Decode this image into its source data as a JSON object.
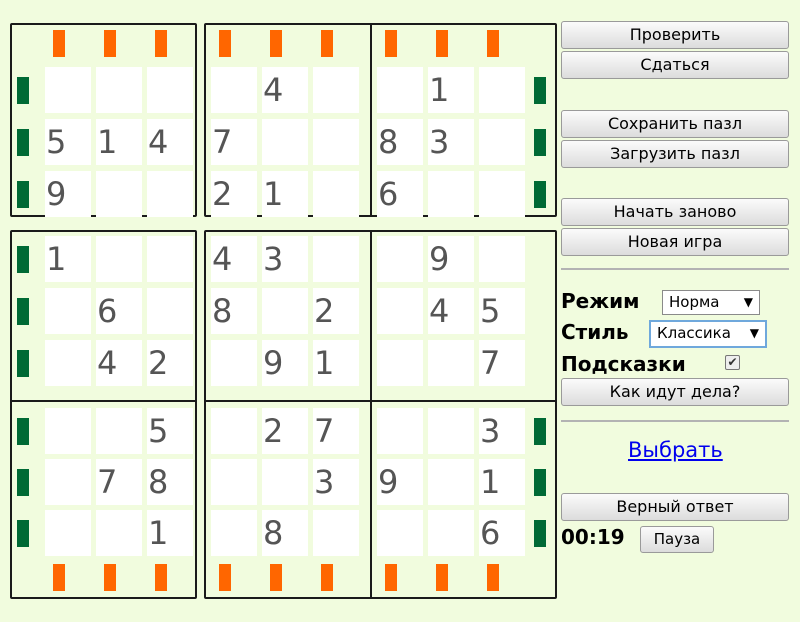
{
  "puzzle": {
    "boxes": [
      [
        [
          "",
          "",
          ""
        ],
        [
          "5",
          "1",
          "4"
        ],
        [
          "9",
          "",
          ""
        ]
      ],
      [
        [
          "",
          "4",
          ""
        ],
        [
          "7",
          "",
          ""
        ],
        [
          "2",
          "1",
          ""
        ]
      ],
      [
        [
          "",
          "1",
          ""
        ],
        [
          "8",
          "3",
          ""
        ],
        [
          "6",
          "",
          ""
        ]
      ],
      [
        [
          "1",
          "",
          ""
        ],
        [
          "",
          "6",
          ""
        ],
        [
          "",
          "4",
          "2"
        ]
      ],
      [
        [
          "4",
          "3",
          ""
        ],
        [
          "8",
          "",
          "2"
        ],
        [
          "",
          "9",
          "1"
        ]
      ],
      [
        [
          "",
          "9",
          ""
        ],
        [
          "",
          "4",
          "5"
        ],
        [
          "",
          "",
          "7"
        ]
      ],
      [
        [
          "",
          "",
          "5"
        ],
        [
          "",
          "7",
          "8"
        ],
        [
          "",
          "",
          "1"
        ]
      ],
      [
        [
          "",
          "2",
          "7"
        ],
        [
          "",
          "",
          "3"
        ],
        [
          "",
          "8",
          ""
        ]
      ],
      [
        [
          "",
          "",
          "3"
        ],
        [
          "9",
          "",
          "1"
        ],
        [
          "",
          "",
          "6"
        ]
      ]
    ]
  },
  "colors": {
    "background": "#f1fcde",
    "orange_mark": "#ff6600",
    "green_mark": "#006a35",
    "digit": "#555555",
    "link": "#0000ee"
  },
  "panel": {
    "check": "Проверить",
    "give_up": "Сдаться",
    "save": "Сохранить пазл",
    "load": "Загрузить пазл",
    "restart": "Начать заново",
    "new_game": "Новая игра",
    "mode_label": "Режим",
    "mode_value": "Норма",
    "style_label": "Стиль",
    "style_value": "Классика",
    "hints_label": "Подсказки",
    "hints_checked": true,
    "how_going": "Как идут дела?",
    "choose_link": "Выбрать",
    "correct_answer": "Верный ответ",
    "timer": "00:19",
    "pause": "Пауза"
  }
}
